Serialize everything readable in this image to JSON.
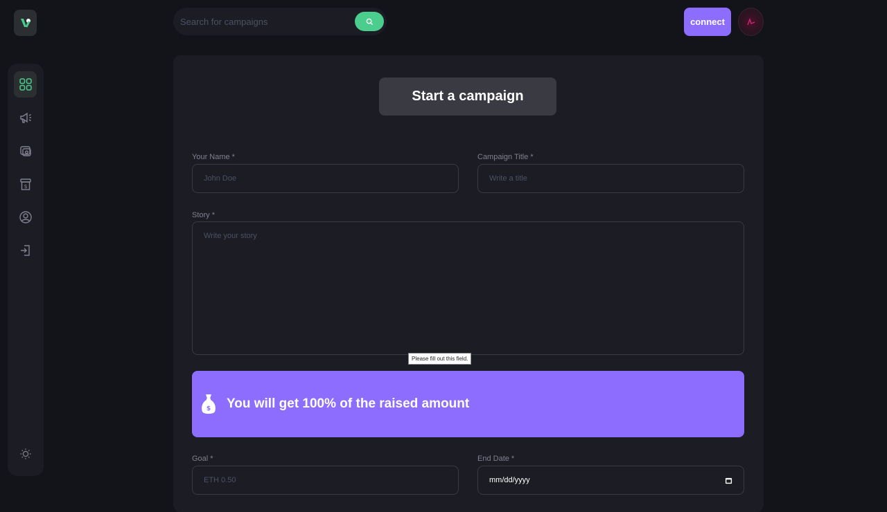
{
  "search": {
    "placeholder": "Search for campaigns",
    "icon": "search-icon"
  },
  "header": {
    "connect_label": "connect"
  },
  "sidebar": {
    "items": [
      {
        "name": "dashboard",
        "icon": "dashboard-icon",
        "active": true
      },
      {
        "name": "campaign",
        "icon": "megaphone-icon"
      },
      {
        "name": "payment",
        "icon": "payment-icon"
      },
      {
        "name": "withdraw",
        "icon": "withdraw-icon"
      },
      {
        "name": "profile",
        "icon": "profile-icon"
      },
      {
        "name": "logout",
        "icon": "logout-icon"
      }
    ],
    "theme_icon": "sun-icon"
  },
  "form": {
    "title": "Start a campaign",
    "name": {
      "label": "Your Name *",
      "placeholder": "John Doe"
    },
    "campaign_title": {
      "label": "Campaign Title *",
      "placeholder": "Write a title"
    },
    "story": {
      "label": "Story *",
      "placeholder": "Write your story"
    },
    "validation_tooltip": "Please fill out this field.",
    "banner": {
      "text": "You will get 100% of the raised amount",
      "icon": "money-bag-icon"
    },
    "goal": {
      "label": "Goal *",
      "placeholder": "ETH 0.50"
    },
    "end_date": {
      "label": "End Date *",
      "value": "mm/dd/yyyy",
      "icon": "calendar-icon"
    }
  },
  "colors": {
    "accent_green": "#4acd8d",
    "accent_purple": "#8c6dfd",
    "background": "#13131a",
    "panel": "#1c1c24"
  }
}
